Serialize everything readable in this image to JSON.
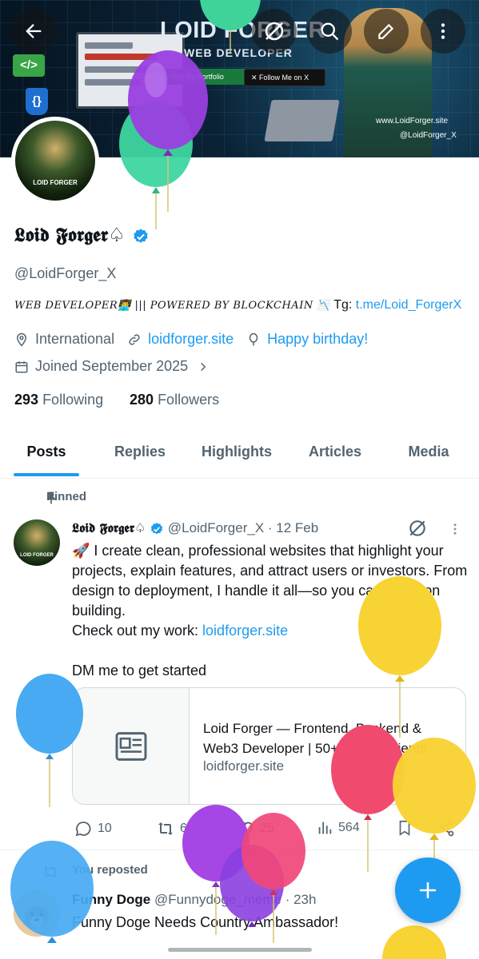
{
  "banner": {
    "title": "LOID FORGER",
    "subtitle": "WEB DEVELOPER",
    "portfolio_btn": "Visit My Portfolio",
    "follow_btn": "✕  Follow Me on X",
    "site": "www.LoidForger.site",
    "x_handle": "@LoidForger_X",
    "code_badge": "</>",
    "brace_badge": "{}"
  },
  "avatar": {
    "label": "LOID FORGER"
  },
  "profile": {
    "name": "𝕷𝖔𝖎𝖉 𝕱𝖔𝖗𝖌𝖊𝖗♤",
    "handle": "@LoidForger_X",
    "bio_prefix": "WEB DEVELOPER👨‍💻 ||| POWERED BY BLOCKCHAIN 📉",
    "bio_tg_label": "Tg:",
    "bio_tg_link": "t.me/Loid_ForgerX",
    "location": "International",
    "website": "loidforger.site",
    "birthday": "Happy birthday!",
    "joined": "Joined September 2025",
    "following_count": "293",
    "following_label": "Following",
    "followers_count": "280",
    "followers_label": "Followers"
  },
  "tabs": [
    "Posts",
    "Replies",
    "Highlights",
    "Articles",
    "Media"
  ],
  "pinned_post": {
    "pinned_label": "Pinned",
    "author": "𝕷𝖔𝖎𝖉 𝕱𝖔𝖗𝖌𝖊𝖗♤",
    "handle": "@LoidForger_X",
    "date": "· 12 Feb",
    "line1": "🚀 I create clean, professional websites that highlight your projects, explain features, and attract users or investors. From design to deployment, I handle it all—so you can focus on building.",
    "line2_prefix": "Check out my work: ",
    "line2_link": "loidforger.site",
    "line3": "DM me to get started",
    "card_title": "Loid Forger — Frontend, Backend & Web3 Developer | 50+ Happy Clients",
    "card_domain": "loidforger.site",
    "replies": "10",
    "reposts": "6",
    "likes": "25",
    "views": "564"
  },
  "second_post": {
    "reposted_label": "You reposted",
    "author": "Funny Doge",
    "handle": "@Funnydoge_meme",
    "time": "· 23h",
    "body": "Funny Doge Needs Country Ambassador!"
  },
  "colors": {
    "accent": "#1d9bf0",
    "text": "#0f1419",
    "muted": "#536471"
  }
}
